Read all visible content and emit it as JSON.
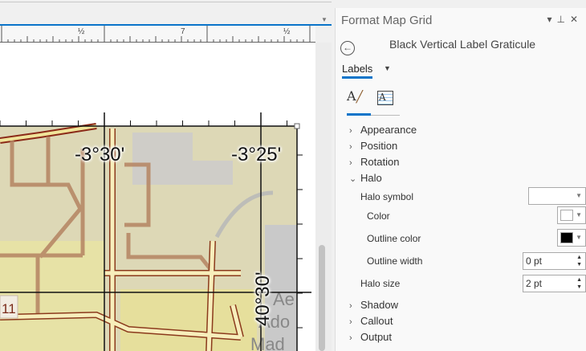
{
  "ruler": {
    "labels": [
      "½",
      "7",
      "½"
    ]
  },
  "map": {
    "labels": {
      "top_left": "-3°30'",
      "top_right": "-3°25'",
      "right": "40°30'"
    },
    "route_shield": "11",
    "place_text": [
      "Ae",
      "Ado",
      "Mad"
    ]
  },
  "panel": {
    "title": "Format Map Grid",
    "header_icons": [
      "dropdown-icon",
      "pin-icon",
      "close-icon"
    ],
    "subtitle": "Black Vertical Label Graticule",
    "tab": "Labels",
    "sections": [
      {
        "label": "Appearance",
        "expanded": false
      },
      {
        "label": "Position",
        "expanded": false
      },
      {
        "label": "Rotation",
        "expanded": false
      },
      {
        "label": "Halo",
        "expanded": true
      },
      {
        "label": "Shadow",
        "expanded": false
      },
      {
        "label": "Callout",
        "expanded": false
      },
      {
        "label": "Output",
        "expanded": false
      }
    ],
    "halo": {
      "symbol_label": "Halo symbol",
      "color_label": "Color",
      "color_value": "#ffffff",
      "outline_color_label": "Outline color",
      "outline_color_value": "#000000",
      "outline_width_label": "Outline width",
      "outline_width_value": "0 pt",
      "size_label": "Halo size",
      "size_value": "2 pt"
    },
    "accent": "#0a74c9"
  }
}
